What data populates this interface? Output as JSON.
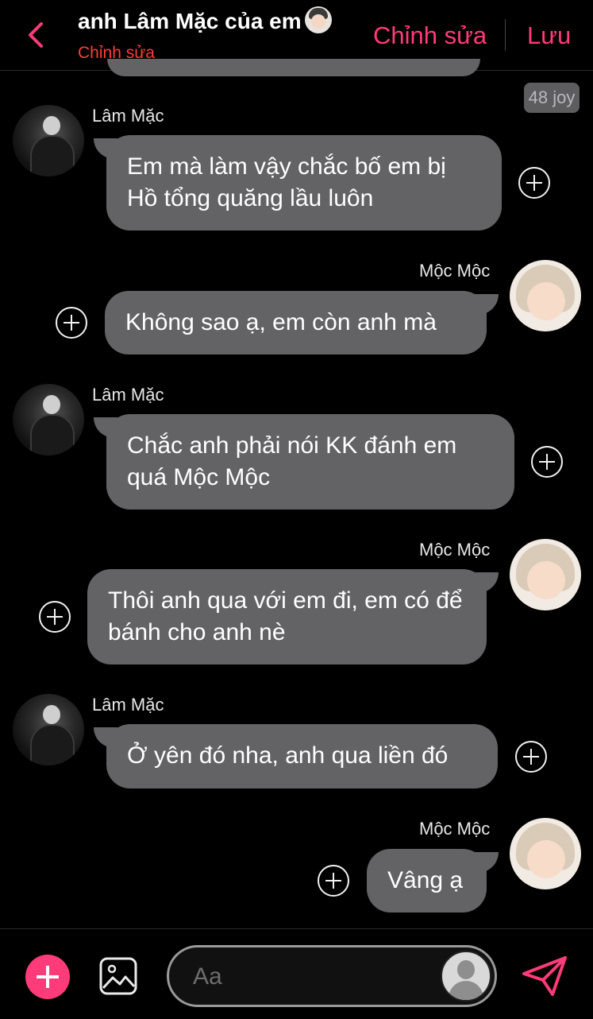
{
  "header": {
    "title": "anh Lâm Mặc của em",
    "subtitle": "Chỉnh sửa",
    "edit_label": "Chỉnh sửa",
    "save_label": "Lưu"
  },
  "counter": "48 joy",
  "messages": [
    {
      "sender": "Lâm Mặc",
      "side": "left",
      "text": "Em mà làm vậy chắc bố em bị Hồ tổng quăng lầu luôn"
    },
    {
      "sender": "Mộc Mộc",
      "side": "right",
      "text": "Không sao ạ, em còn anh mà"
    },
    {
      "sender": "Lâm Mặc",
      "side": "left",
      "text": "Chắc anh phải nói KK đánh em quá Mộc Mộc"
    },
    {
      "sender": "Mộc Mộc",
      "side": "right",
      "text": "Thôi anh qua với em đi, em có để bánh cho anh nè"
    },
    {
      "sender": "Lâm Mặc",
      "side": "left",
      "text": "Ở yên đó nha, anh qua liền đó"
    },
    {
      "sender": "Mộc Mộc",
      "side": "right",
      "text": "Vâng ạ"
    }
  ],
  "composer": {
    "placeholder": "Aa"
  },
  "colors": {
    "accent": "#ff3b7a",
    "bubble": "#636366",
    "background": "#000000"
  },
  "icons": [
    "back-chevron-icon",
    "plus-circle-icon",
    "add-icon",
    "image-icon",
    "send-icon"
  ]
}
